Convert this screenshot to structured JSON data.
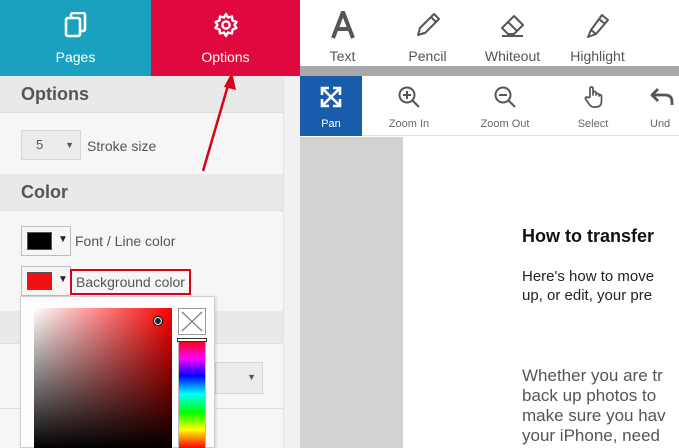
{
  "tabs": {
    "pages_label": "Pages",
    "options_label": "Options"
  },
  "main_toolbar": {
    "text_label": "Text",
    "pencil_label": "Pencil",
    "whiteout_label": "Whiteout",
    "highlight_label": "Highlight"
  },
  "sub_toolbar": {
    "pan_label": "Pan",
    "zoom_in_label": "Zoom In",
    "zoom_out_label": "Zoom Out",
    "select_label": "Select",
    "undo_label": "Und"
  },
  "panel": {
    "options_header": "Options",
    "stroke_size_value": "5",
    "stroke_size_label": "Stroke size",
    "color_header": "Color",
    "font_color_label": "Font / Line color",
    "font_color_value": "#000000",
    "background_color_label": "Background color",
    "background_color_value": "#ee1111"
  },
  "document": {
    "heading": "How to transfer",
    "para1_line1": "Here's how to move",
    "para1_line2": "up, or edit, your pre",
    "para2_line1": "Whether you are tr",
    "para2_line2": "back up photos to",
    "para2_line3": "make sure you hav",
    "para2_line4": "your iPhone, need"
  },
  "colors": {
    "pages_tab": "#1aa1bf",
    "options_tab": "#e0093e",
    "pan_active": "#1a5cac",
    "annotation": "#d9001b"
  }
}
